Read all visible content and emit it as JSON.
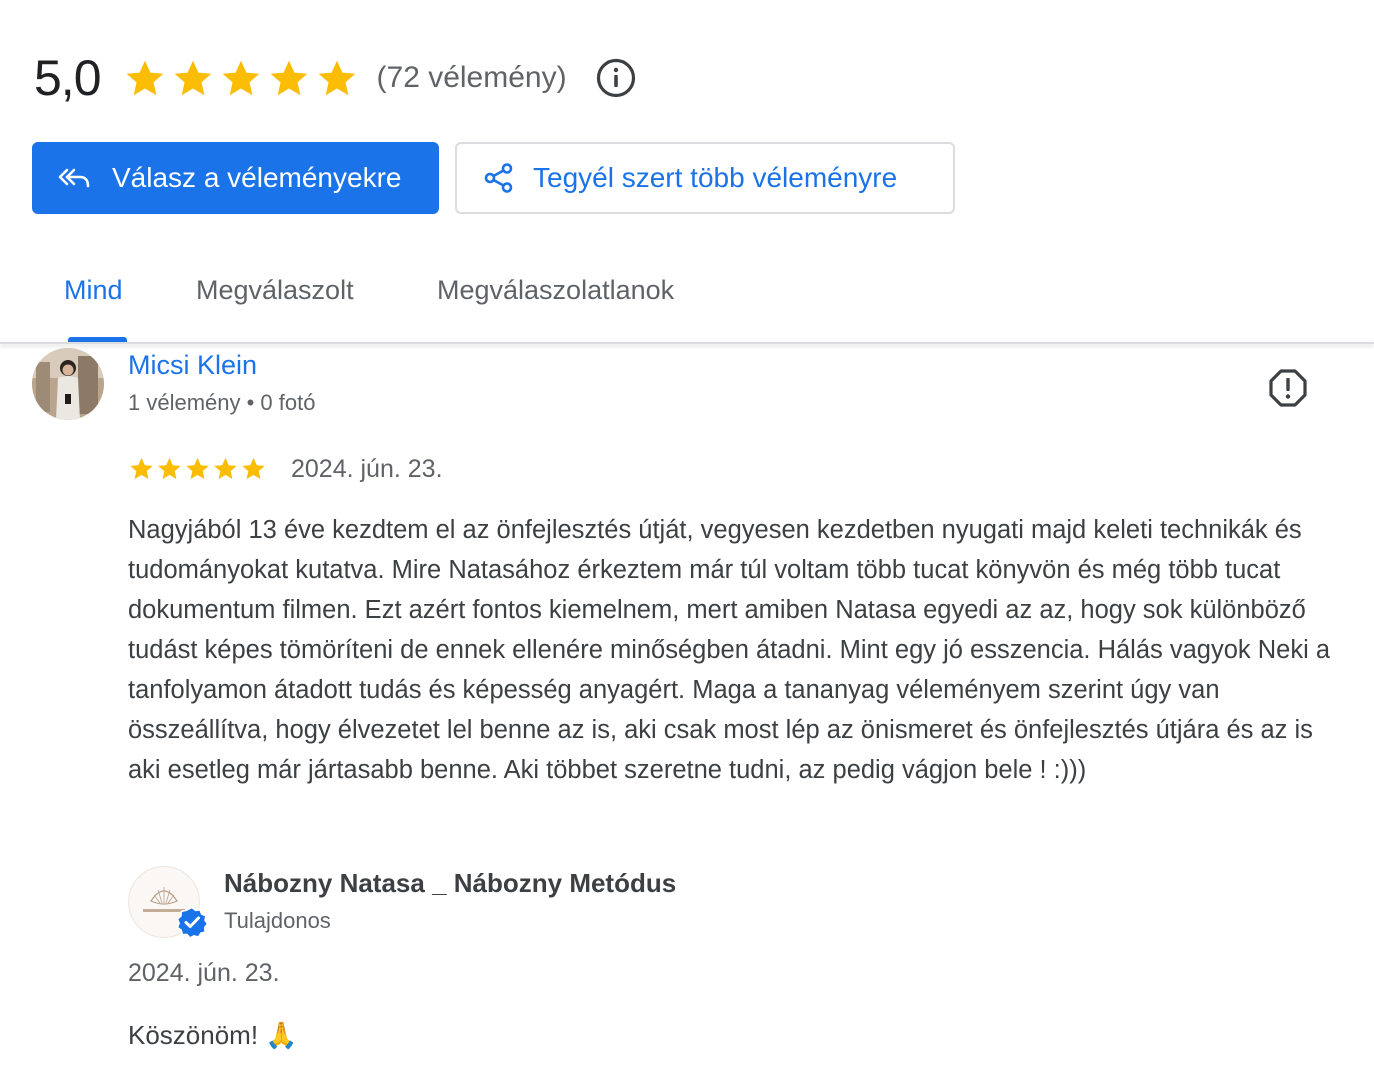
{
  "summary": {
    "rating": "5,0",
    "stars": 5,
    "review_count": "(72 vélemény)",
    "info_icon": "info-icon",
    "star_color": "#fbbc04"
  },
  "actions": {
    "reply_label": "Válasz a véleményekre",
    "reply_icon": "reply-all-icon",
    "share_label": "Tegyél szert több véleményre",
    "share_icon": "share-icon",
    "primary_color": "#1a73e8"
  },
  "tabs": [
    {
      "label": "Mind",
      "active": true
    },
    {
      "label": "Megválaszolt",
      "active": false
    },
    {
      "label": "Megválaszolatlanok",
      "active": false
    }
  ],
  "review": {
    "author": "Micsi Klein",
    "author_meta": "1 vélemény • 0 fotó",
    "stars": 5,
    "date": "2024. jún. 23.",
    "text": "Nagyjából 13 éve kezdtem el az önfejlesztés útját, vegyesen kezdetben nyugati majd keleti technikák és tudományokat kutatva. Mire Natasához érkeztem már túl voltam több tucat könyvön és még több tucat dokumentum filmen. Ezt azért fontos kiemelnem, mert amiben Natasa egyedi az az, hogy sok különböző tudást képes tömöríteni de ennek ellenére minőségben átadni. Mint egy jó esszencia. Hálás vagyok Neki a tanfolyamon átadott tudás és képesség anyagért. Maga a tananyag véleményem szerint úgy van összeállítva, hogy élvezetet lel benne az is, aki csak most lép az önismeret és önfejlesztés útjára és az is aki esetleg már jártasabb benne. Aki többet szeretne tudni, az pedig vágjon bele ! :)))",
    "flag_icon": "report-icon"
  },
  "owner_reply": {
    "name": "Nábozny Natasa _ Nábozny Metódus",
    "role": "Tulajdonos",
    "date": "2024. jún. 23.",
    "text": "Köszönöm! 🙏",
    "verified_icon": "verified-badge-icon"
  }
}
